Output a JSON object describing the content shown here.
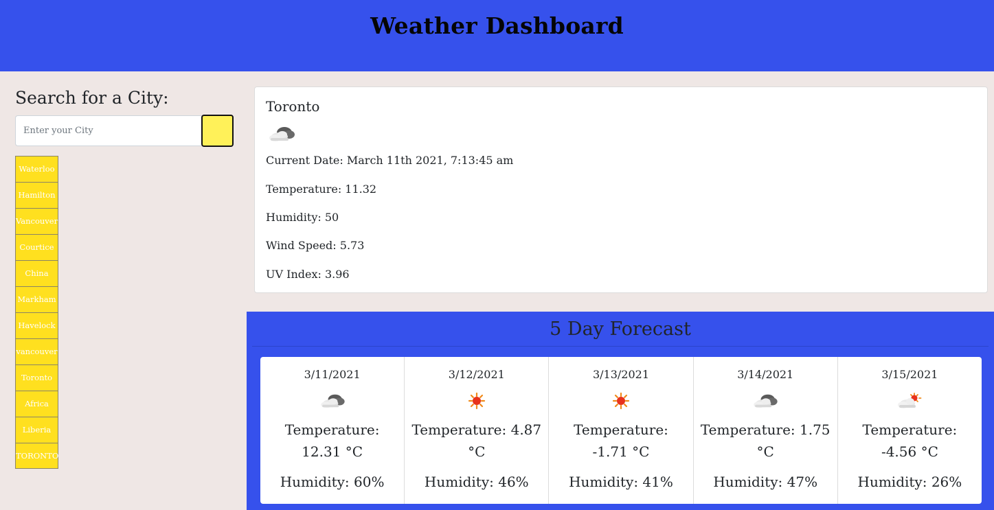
{
  "header": {
    "title": "Weather Dashboard",
    "color": "#3651ec"
  },
  "search": {
    "title": "Search for a City:",
    "placeholder": "Enter your City",
    "value": "",
    "button_color": "#fff159"
  },
  "history": {
    "color": "#ffe01f",
    "items": [
      {
        "label": "Waterloo"
      },
      {
        "label": "Hamilton"
      },
      {
        "label": "Vancouver"
      },
      {
        "label": "Courtice"
      },
      {
        "label": "China"
      },
      {
        "label": "Markham"
      },
      {
        "label": "Havelock"
      },
      {
        "label": "vancouver"
      },
      {
        "label": "Toronto"
      },
      {
        "label": "Africa"
      },
      {
        "label": "Liberia"
      },
      {
        "label": "TORONTO"
      }
    ]
  },
  "current": {
    "city": "Toronto",
    "icon": "cloud-icon",
    "date_line": "Current Date: March 11th 2021, 7:13:45 am",
    "temperature_line": "Temperature: 11.32",
    "humidity_line": "Humidity: 50",
    "wind_line": "Wind Speed: 5.73",
    "uv_line": "UV Index: 3.96"
  },
  "forecast": {
    "title": "5 Day Forecast",
    "days": [
      {
        "date": "3/11/2021",
        "icon": "cloud-icon",
        "temperature": "Temperature: 12.31 °C",
        "humidity": "Humidity: 60%"
      },
      {
        "date": "3/12/2021",
        "icon": "sun-icon",
        "temperature": "Temperature: 4.87 °C",
        "humidity": "Humidity: 46%"
      },
      {
        "date": "3/13/2021",
        "icon": "sun-icon",
        "temperature": "Temperature: -1.71 °C",
        "humidity": "Humidity: 41%"
      },
      {
        "date": "3/14/2021",
        "icon": "cloud-icon",
        "temperature": "Temperature: 1.75 °C",
        "humidity": "Humidity: 47%"
      },
      {
        "date": "3/15/2021",
        "icon": "partly-cloudy-icon",
        "temperature": "Temperature: -4.56 °C",
        "humidity": "Humidity: 26%"
      }
    ]
  }
}
